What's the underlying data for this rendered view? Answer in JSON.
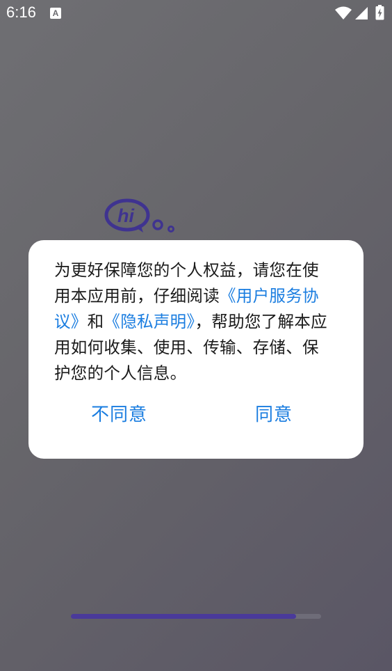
{
  "status_bar": {
    "time": "6:16",
    "notification_icon_letter": "A",
    "icons": [
      "wifi-icon",
      "cellular-signal-icon",
      "battery-charging-icon"
    ]
  },
  "background": {
    "logo_text": "hi",
    "logo_color": "#3f3390"
  },
  "dialog": {
    "text_1": "为更好保障您的个人权益，请您在使用本应用前，仔细阅读",
    "link_user_agreement": "《用户服务协议》",
    "text_2": "和",
    "link_privacy": "《隐私声明》",
    "text_3": "，帮助您了解本应用如何收集、使用、传输、存储、保护您的个人信息。",
    "decline_label": "不同意",
    "agree_label": "同意",
    "link_color": "#1a7de0"
  },
  "loading": {
    "progress": 0.9
  }
}
